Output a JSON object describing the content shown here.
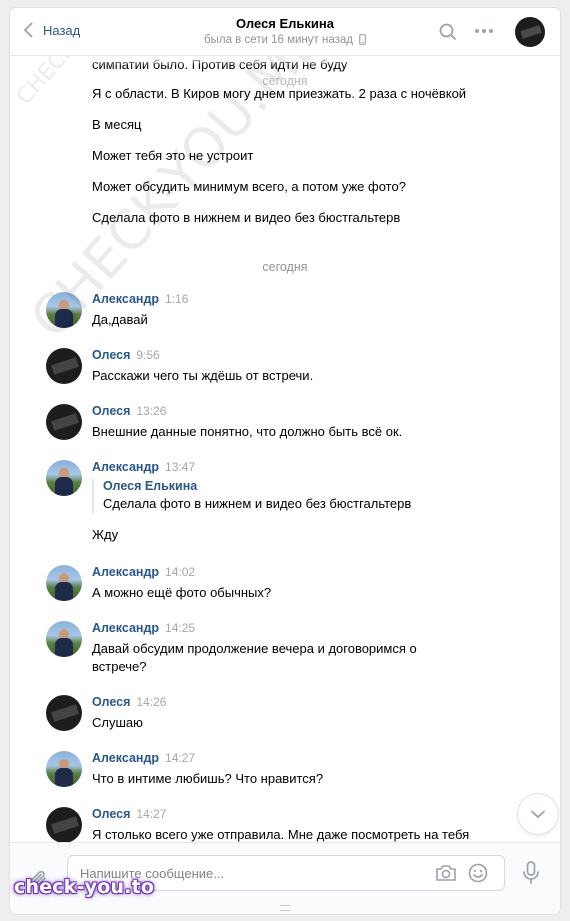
{
  "header": {
    "back_label": "Назад",
    "peer_name": "Олеся Елькина",
    "peer_status": "была в сети 16 минут назад"
  },
  "earlier": {
    "partial_line": "симпатии было. Против себя идти не буду",
    "date_overlap": "сегодня",
    "lines": [
      "Я с области. В Киров могу днем приезжать. 2 раза с ночёвкой",
      "В месяц",
      "Может тебя это не устроит",
      "Может обсудить минимум всего, а потом уже фото?",
      "Сделала фото в нижнем и видео без бюстгальтерв"
    ]
  },
  "date_separator": "сегодня",
  "messages": [
    {
      "author": "Александр",
      "time": "1:16",
      "text": "Да,давай"
    },
    {
      "author": "Олеся",
      "time": "9:56",
      "text": "Расскажи чего ты ждёшь от встречи."
    },
    {
      "author": "Олеся",
      "time": "13:26",
      "text": "Внешние данные понятно, что должно быть всё ок."
    },
    {
      "author": "Александр",
      "time": "13:47",
      "quote_author": "Олеся Елькина",
      "quote_text": "Сделала фото в нижнем и видео без бюстгальтерв",
      "text": "Жду"
    },
    {
      "author": "Александр",
      "time": "14:02",
      "text": "А можно ещё фото обычных?"
    },
    {
      "author": "Александр",
      "time": "14:25",
      "text": "Давай обсудим продолжение вечера и договоримся о встрече?"
    },
    {
      "author": "Олеся",
      "time": "14:26",
      "text": "Слушаю"
    },
    {
      "author": "Александр",
      "time": "14:27",
      "text": "Что в интиме любишь? Что нравится?"
    },
    {
      "author": "Олеся",
      "time": "14:27",
      "text": "Я столько всего уже отправила. Мне даже посмотреть на тебя"
    }
  ],
  "composer": {
    "placeholder": "Напишите сообщение..."
  },
  "watermarks": {
    "small": "CHECK-YOU.ME",
    "large": "CHECK-YOU.ME",
    "badge": "check-you.to"
  },
  "icons": [
    "back-chevron-icon",
    "search-icon",
    "more-icon",
    "phone-icon",
    "chevron-down-icon",
    "paperclip-icon",
    "camera-icon",
    "emoji-icon",
    "microphone-icon"
  ],
  "colors": {
    "link": "#2a5885",
    "time": "#a6a6a6",
    "background": "#edeef0",
    "badge_glow": "#7a3fb8"
  }
}
